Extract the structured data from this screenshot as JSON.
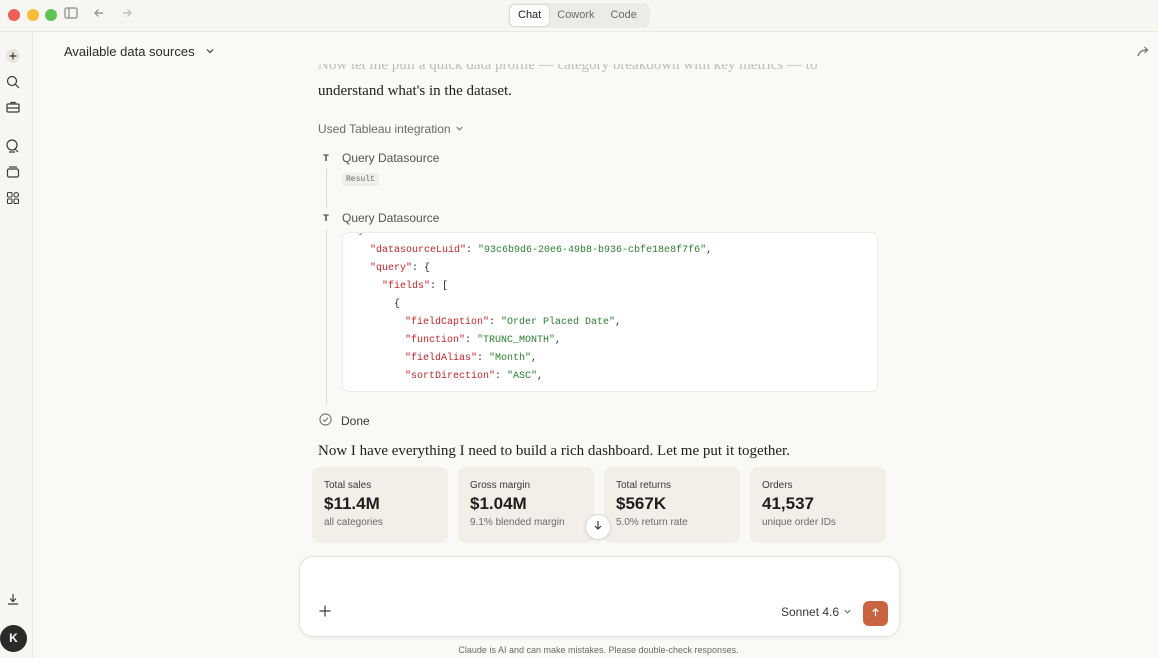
{
  "titlebar": {
    "tabs": [
      {
        "label": "Chat",
        "active": true
      },
      {
        "label": "Cowork",
        "active": false
      },
      {
        "label": "Code",
        "active": false
      }
    ]
  },
  "sidebar": {
    "icons": [
      "new-chat-icon",
      "search-icon",
      "toolbox-icon",
      "chats-icon",
      "projects-icon",
      "artifacts-icon",
      "download-icon"
    ],
    "avatar_initial": "K"
  },
  "header": {
    "source_label": "Available data sources"
  },
  "conversation": {
    "faded_text": "Now let me pull a quick data profile — category breakdown with key metrics — to",
    "intro_text": "understand what's in the dataset.",
    "integration_label": "Used Tableau integration",
    "steps": [
      {
        "badge": "T",
        "label": "Query Datasource",
        "result": "Result"
      },
      {
        "badge": "T",
        "label": "Query Datasource"
      }
    ],
    "code": [
      {
        "key": "\"datasourceLuid\"",
        "sep": ": ",
        "value": "\"93c6b9d6-20e6-49b8-b936-cbfe18e8f7f6\"",
        "tail": ","
      },
      {
        "key": "\"query\"",
        "sep": ": {",
        "value": "",
        "tail": ""
      },
      {
        "key": "\"fields\"",
        "sep": ": [",
        "value": "",
        "tail": ""
      },
      {
        "key": "",
        "sep": "{",
        "value": "",
        "tail": ""
      },
      {
        "key": "\"fieldCaption\"",
        "sep": ": ",
        "value": "\"Order Placed Date\"",
        "tail": ","
      },
      {
        "key": "\"function\"",
        "sep": ": ",
        "value": "\"TRUNC_MONTH\"",
        "tail": ","
      },
      {
        "key": "\"fieldAlias\"",
        "sep": ": ",
        "value": "\"Month\"",
        "tail": ","
      },
      {
        "key": "\"sortDirection\"",
        "sep": ": ",
        "value": "\"ASC\"",
        "tail": ","
      }
    ],
    "done_label": "Done",
    "final_text": "Now I have everything I need to build a rich dashboard. Let me put it together."
  },
  "cards": [
    {
      "label": "Total sales",
      "value": "$11.4M",
      "sub": "all categories"
    },
    {
      "label": "Gross margin",
      "value": "$1.04M",
      "sub": "9.1% blended margin"
    },
    {
      "label": "Total returns",
      "value": "$567K",
      "sub": "5.0% return rate"
    },
    {
      "label": "Orders",
      "value": "41,537",
      "sub": "unique order IDs"
    }
  ],
  "composer": {
    "placeholder": "",
    "model": "Sonnet 4.6"
  },
  "disclaimer": "Claude is AI and can make mistakes. Please double-check responses.",
  "colors": {
    "accent": "#c96442",
    "background": "#faf9f5",
    "card": "#f1efe8"
  }
}
